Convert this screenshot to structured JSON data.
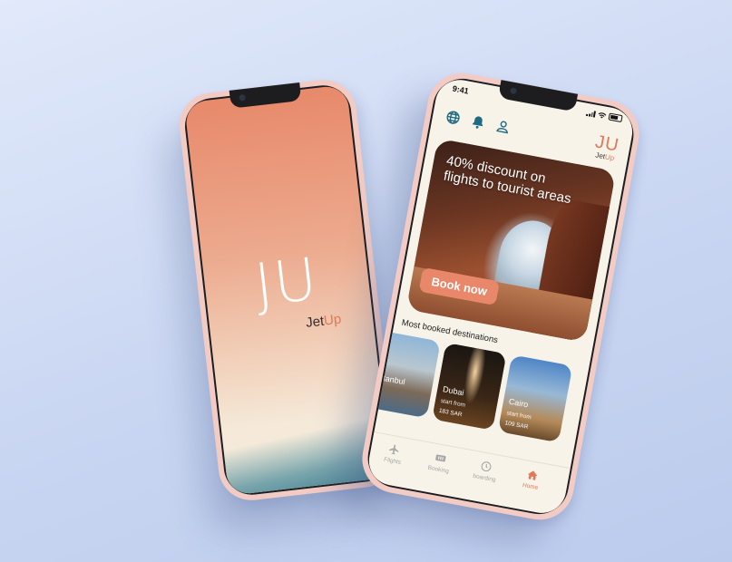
{
  "splash": {
    "logo_monogram": "JU",
    "logo_word_prefix": "Jet",
    "logo_word_suffix": "Up"
  },
  "home": {
    "status_time": "9:41",
    "top_icons": [
      "globe-icon",
      "bell-icon",
      "user-icon"
    ],
    "brand_monogram": "JU",
    "brand_word_prefix": "Jet",
    "brand_word_suffix": "Up",
    "hero": {
      "headline": "40% discount on flights to tourist areas",
      "cta_label": "Book now"
    },
    "section_title": "Most booked destinations",
    "destinations": [
      {
        "name": "Istanbul",
        "start_label": "",
        "price": ""
      },
      {
        "name": "Dubai",
        "start_label": "start from",
        "price": "183 SAR"
      },
      {
        "name": "Cairo",
        "start_label": "start from",
        "price": "109 SAR"
      }
    ],
    "tabs": [
      {
        "label": "Flights",
        "icon": "plane-icon",
        "active": false
      },
      {
        "label": "Booking",
        "icon": "ticket-icon",
        "active": false
      },
      {
        "label": "boarding",
        "icon": "clock-icon",
        "active": false
      },
      {
        "label": "Home",
        "icon": "home-icon",
        "active": true
      }
    ]
  },
  "colors": {
    "accent": "#e2785a",
    "icon_teal": "#1f6b84",
    "background": "#d4def4"
  }
}
